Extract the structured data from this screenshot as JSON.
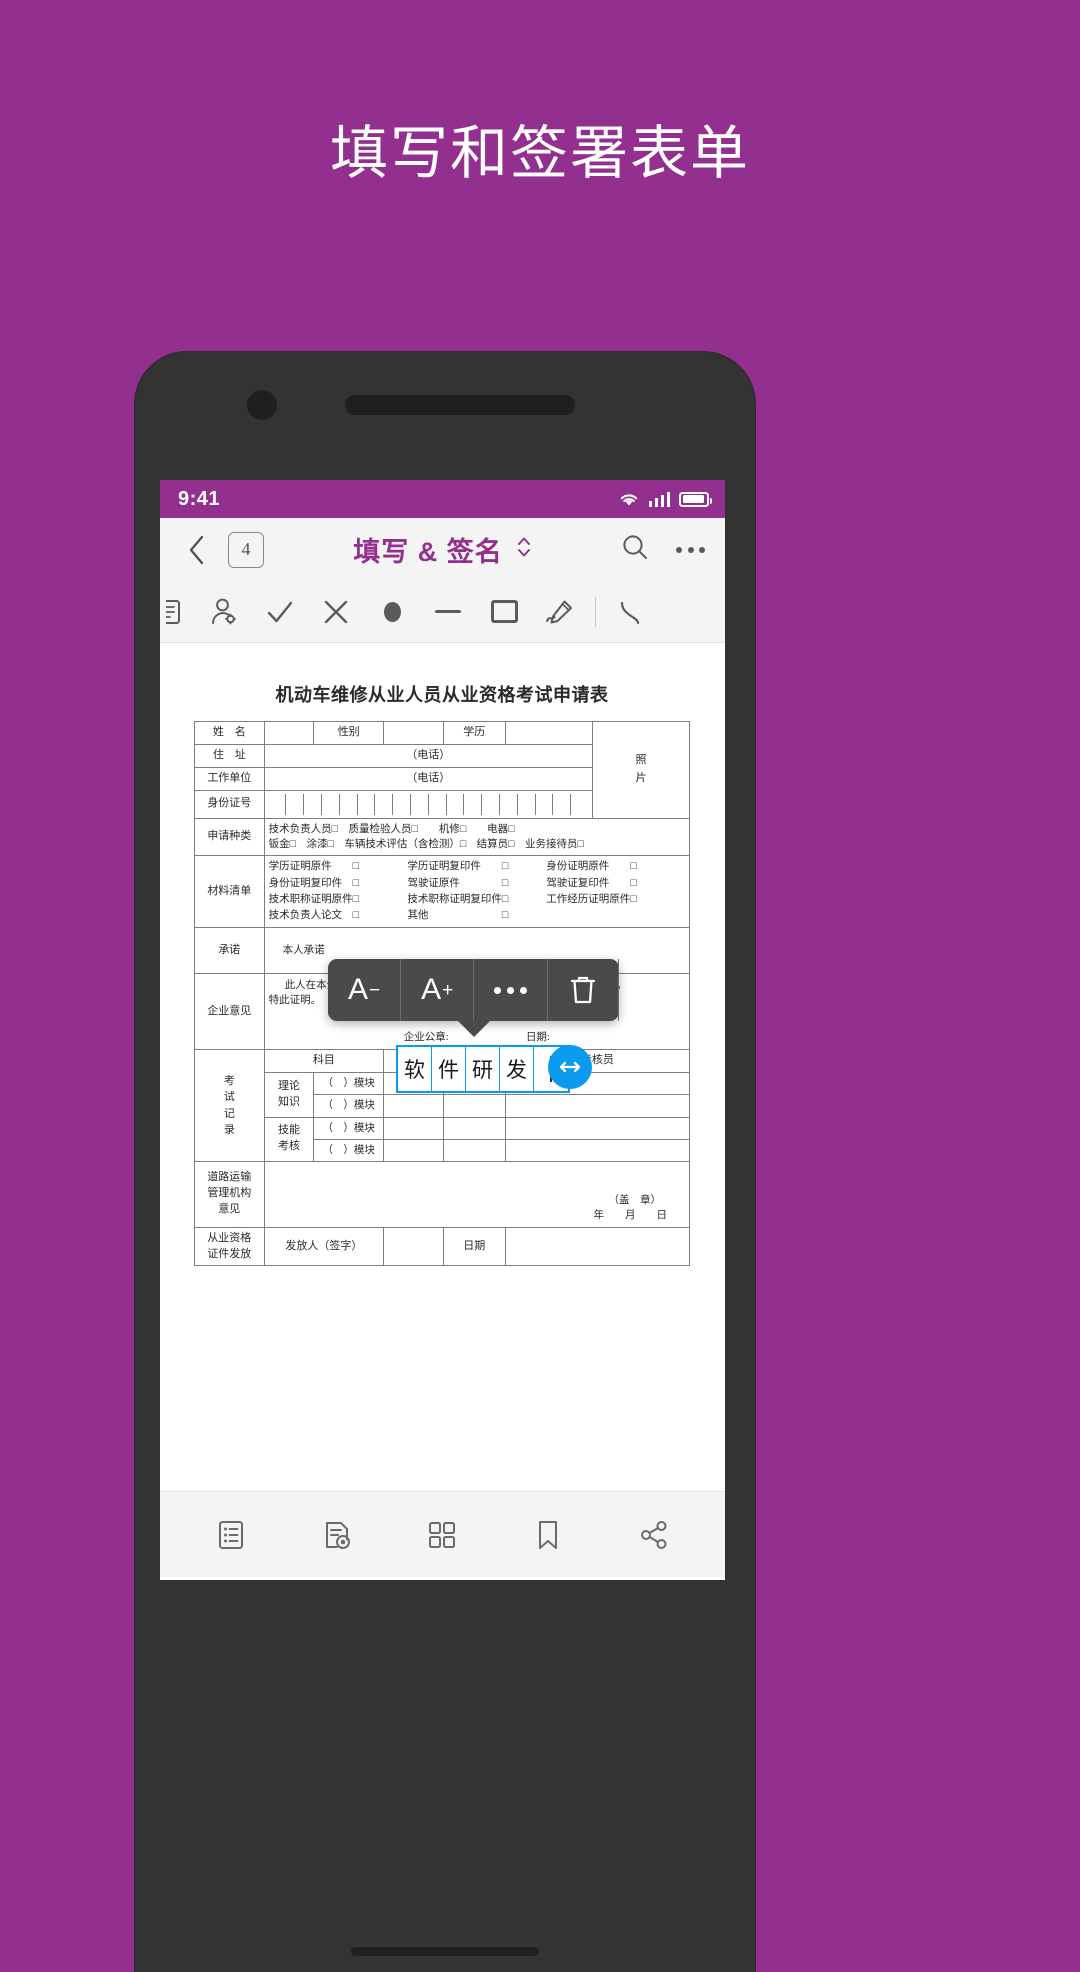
{
  "headline": "填写和签署表单",
  "theme": {
    "brand": "#93308f",
    "accent_blue": "#0a9bef",
    "toolbar_bg": "#f4f4f4",
    "popup_bg": "#4a4a4a"
  },
  "statusbar": {
    "time": "9:41",
    "wifi_icon": "wifi-icon",
    "signal_icon": "cellular-signal-icon",
    "battery_icon": "battery-icon"
  },
  "navbar": {
    "back_icon": "chevron-left-icon",
    "page_number": "4",
    "title": "填写 & 签名",
    "title_chevrons_icon": "chevron-up-down-icon",
    "search_icon": "search-icon",
    "more_icon": "more-horizontal-icon"
  },
  "annotation_toolbar": {
    "tools": [
      {
        "name": "form-field-icon",
        "label": "表单域"
      },
      {
        "name": "person-settings-icon",
        "label": "签署人设置"
      },
      {
        "name": "checkmark-icon",
        "label": "对勾"
      },
      {
        "name": "cross-icon",
        "label": "叉号"
      },
      {
        "name": "dot-icon",
        "label": "圆点"
      },
      {
        "name": "line-icon",
        "label": "横线"
      },
      {
        "name": "rectangle-icon",
        "label": "矩形"
      },
      {
        "name": "signature-pen-icon",
        "label": "签名"
      },
      {
        "name": "undo-icon",
        "label": "撤销"
      }
    ]
  },
  "popup": {
    "decrease_font_label": "A",
    "decrease_font_sign": "−",
    "increase_font_label": "A",
    "increase_font_sign": "+",
    "more_icon": "more-horizontal-icon",
    "delete_icon": "trash-icon"
  },
  "selection": {
    "chars": [
      "软",
      "件",
      "研",
      "发"
    ],
    "handle_icon": "resize-horizontal-icon"
  },
  "document": {
    "title": "机动车维修从业人员从业资格考试申请表",
    "rows": {
      "name_label": "姓　名",
      "gender_label": "性别",
      "education_label": "学历",
      "address_label": "住　址",
      "phone_note": "（电话）",
      "workunit_label": "工作单位",
      "id_label": "身份证号",
      "photo_label_1": "照",
      "photo_label_2": "片",
      "apply_type_label": "申请种类",
      "apply_type_line1": "技术负责人员□　质量检验人员□　　机修□　　电器□",
      "apply_type_line2": "钣金□　涂漆□　车辆技术评估（含检测）□　结算员□　业务接待员□",
      "materials_label": "材料清单",
      "materials": [
        [
          "学历证明原件　　□",
          "学历证明复印件　　□",
          "身份证明原件　　□"
        ],
        [
          "身份证明复印件　□",
          "驾驶证原件　　　　□",
          "驾驶证复印件　　□"
        ],
        [
          "技术职称证明原件□",
          "技术职称证明复印件□",
          "工作经历证明原件□"
        ],
        [
          "技术负责人论文　□",
          "其他　　　　　　　□",
          ""
        ]
      ],
      "promise_label": "承诺",
      "promise_text": "本人承诺",
      "company_opinion_label": "企业意见",
      "company_opinion_prefix": "此人在本企业从事（",
      "company_opinion_suffix": "）工作（　　）年，",
      "company_opinion_line2": "特此证明。",
      "company_seal": "企业公章:",
      "date_label": "日期:",
      "exam_record_label": "考试记录",
      "exam_head": [
        "科目",
        "成绩",
        "考核员",
        "考核员"
      ],
      "theory_label": "理论知识",
      "skill_label": "技能考核",
      "module_cell": "（　）模块",
      "road_transport_label": "道路运输管理机构意见",
      "seal_note": "（盖　章）",
      "date_line": "年　　月　　日",
      "cert_issue_label": "从业资格证件发放",
      "issuer_label": "发放人（签字）",
      "issue_date_label": "日期"
    }
  },
  "tabbar": {
    "items": [
      {
        "name": "outline-icon",
        "label": "目录"
      },
      {
        "name": "annotations-icon",
        "label": "注释"
      },
      {
        "name": "thumbnails-icon",
        "label": "缩略图"
      },
      {
        "name": "bookmark-icon",
        "label": "书签"
      },
      {
        "name": "share-icon",
        "label": "分享"
      }
    ]
  }
}
